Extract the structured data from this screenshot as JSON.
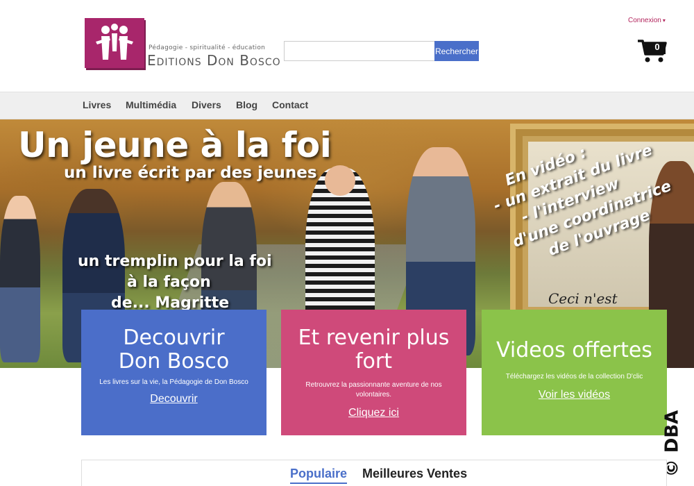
{
  "header": {
    "tagline": "Pédagogie - spiritualité - éducation",
    "brand": "Editions Don Bosco",
    "search": {
      "value": "",
      "button_label": "Rechercher"
    },
    "login_label": "Connexion",
    "cart_count": "0"
  },
  "nav": {
    "items": [
      "Livres",
      "Multimédia",
      "Divers",
      "Blog",
      "Contact"
    ]
  },
  "hero": {
    "title": "Un jeune à la foi",
    "subtitle": "un livre écrit par des jeunes",
    "lines": [
      "un tremplin pour la foi",
      "à la façon",
      "de... Magritte"
    ],
    "painting_text": "Ceci  n'est",
    "video_note": [
      "En vidéo :",
      "- un extrait du livre",
      "- l'interview",
      "d'une coordinatrice",
      "de l'ouvrage"
    ]
  },
  "cards": [
    {
      "title": "Decouvrir Don Bosco",
      "text": "Les livres sur la vie, la Pédagogie de Don Bosco",
      "link": "Decouvrir",
      "color": "#4b6ec9"
    },
    {
      "title": "Et revenir plus fort",
      "text": "Retrouvrez la passionnante aventure de nos volontaires.",
      "link": "Cliquez ici",
      "color": "#cf4a7a"
    },
    {
      "title": "Videos offertes",
      "text": "Téléchargez les vidéos de la collection D'clic",
      "link": "Voir les vidéos",
      "color": "#8bc34a"
    }
  ],
  "watermark": "© DBA",
  "tabs": [
    "Populaire",
    "Meilleures Ventes"
  ]
}
